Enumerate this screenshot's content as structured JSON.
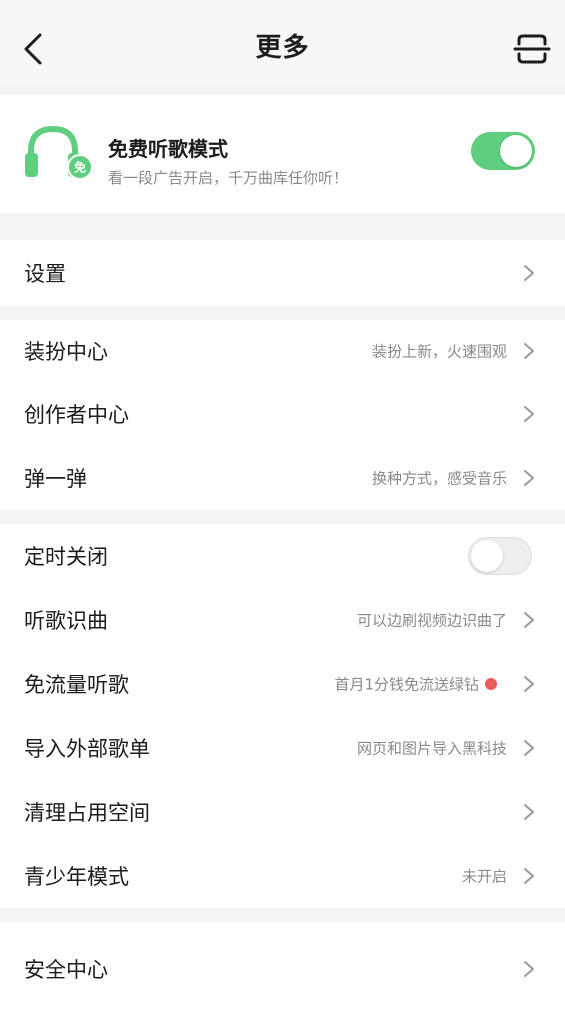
{
  "header": {
    "title": "更多"
  },
  "free_mode": {
    "title": "免费听歌模式",
    "subtitle": "看一段广告开启，千万曲库任你听！",
    "badge": "免",
    "enabled": true,
    "accent": "#5fce7e"
  },
  "sections": {
    "settings": {
      "label": "设置"
    },
    "dress_center": {
      "label": "装扮中心",
      "hint": "装扮上新，火速围观"
    },
    "creator_center": {
      "label": "创作者中心"
    },
    "tan_yi_tan": {
      "label": "弹一弹",
      "hint": "换种方式，感受音乐"
    },
    "timer_close": {
      "label": "定时关闭",
      "enabled": false
    },
    "song_recognize": {
      "label": "听歌识曲",
      "hint": "可以边刷视频边识曲了"
    },
    "free_traffic": {
      "label": "免流量听歌",
      "hint": "首月1分钱免流送绿钻",
      "dot_color": "#e85b5b"
    },
    "import_playlist": {
      "label": "导入外部歌单",
      "hint": "网页和图片导入黑科技"
    },
    "clean_space": {
      "label": "清理占用空间"
    },
    "youth_mode": {
      "label": "青少年模式",
      "hint": "未开启"
    },
    "security_center": {
      "label": "安全中心"
    }
  }
}
